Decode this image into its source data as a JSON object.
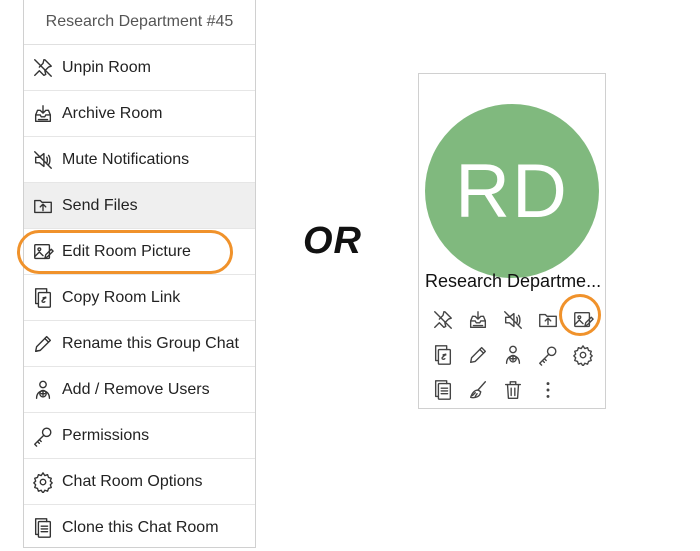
{
  "menu": {
    "header": "Research Department #45",
    "items": [
      {
        "label": "Unpin Room",
        "icon": "unpin-icon"
      },
      {
        "label": "Archive Room",
        "icon": "archive-icon"
      },
      {
        "label": "Mute Notifications",
        "icon": "mute-icon"
      },
      {
        "label": "Send Files",
        "icon": "send-files-icon"
      },
      {
        "label": "Edit Room Picture",
        "icon": "edit-picture-icon"
      },
      {
        "label": "Copy Room Link",
        "icon": "copy-link-icon"
      },
      {
        "label": "Rename this Group Chat",
        "icon": "rename-icon"
      },
      {
        "label": "Add / Remove Users",
        "icon": "add-user-icon"
      },
      {
        "label": "Permissions",
        "icon": "key-icon"
      },
      {
        "label": "Chat Room Options",
        "icon": "gear-icon"
      },
      {
        "label": "Clone this Chat Room",
        "icon": "clone-icon"
      }
    ]
  },
  "separator": "OR",
  "card": {
    "avatar_initials": "RD",
    "avatar_color": "#80b97e",
    "title": "Research Departme..."
  },
  "highlight_color": "#f0922b"
}
